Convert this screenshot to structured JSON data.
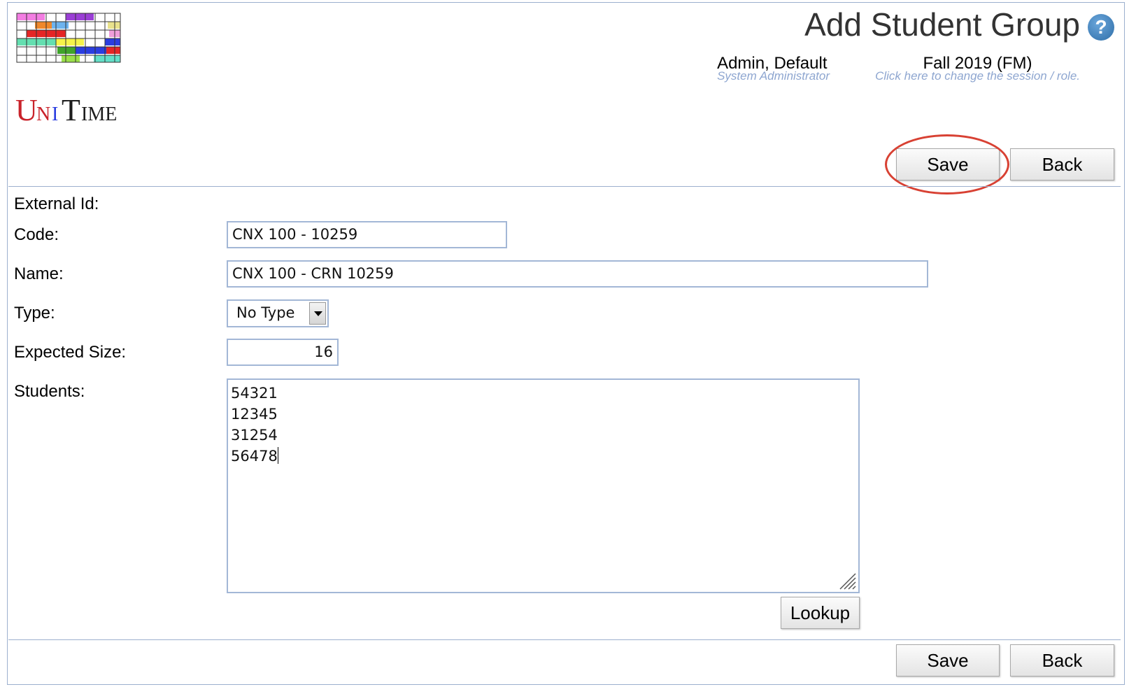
{
  "app": {
    "logo_text": "UniTime"
  },
  "header": {
    "title": "Add Student Group",
    "help_label": "?",
    "user": {
      "name": "Admin, Default",
      "role": "System Administrator"
    },
    "session": {
      "name": "Fall 2019 (FM)",
      "hint": "Click here to change the session / role."
    }
  },
  "toolbar": {
    "save_label": "Save",
    "back_label": "Back"
  },
  "form": {
    "external_id_label": "External Id:",
    "code_label": "Code:",
    "code_value": "CNX 100 - 10259",
    "name_label": "Name:",
    "name_value": "CNX 100 - CRN 10259",
    "type_label": "Type:",
    "type_value": "No Type",
    "expected_size_label": "Expected Size:",
    "expected_size_value": "16",
    "students_label": "Students:",
    "students": [
      "54321",
      "12345",
      "31254",
      "56478"
    ],
    "lookup_label": "Lookup"
  },
  "colors": {
    "accent_border": "#9cb0ce",
    "hint_text": "#8ea6d0",
    "highlight": "#d84133",
    "help_icon": "#2f6ea8"
  }
}
